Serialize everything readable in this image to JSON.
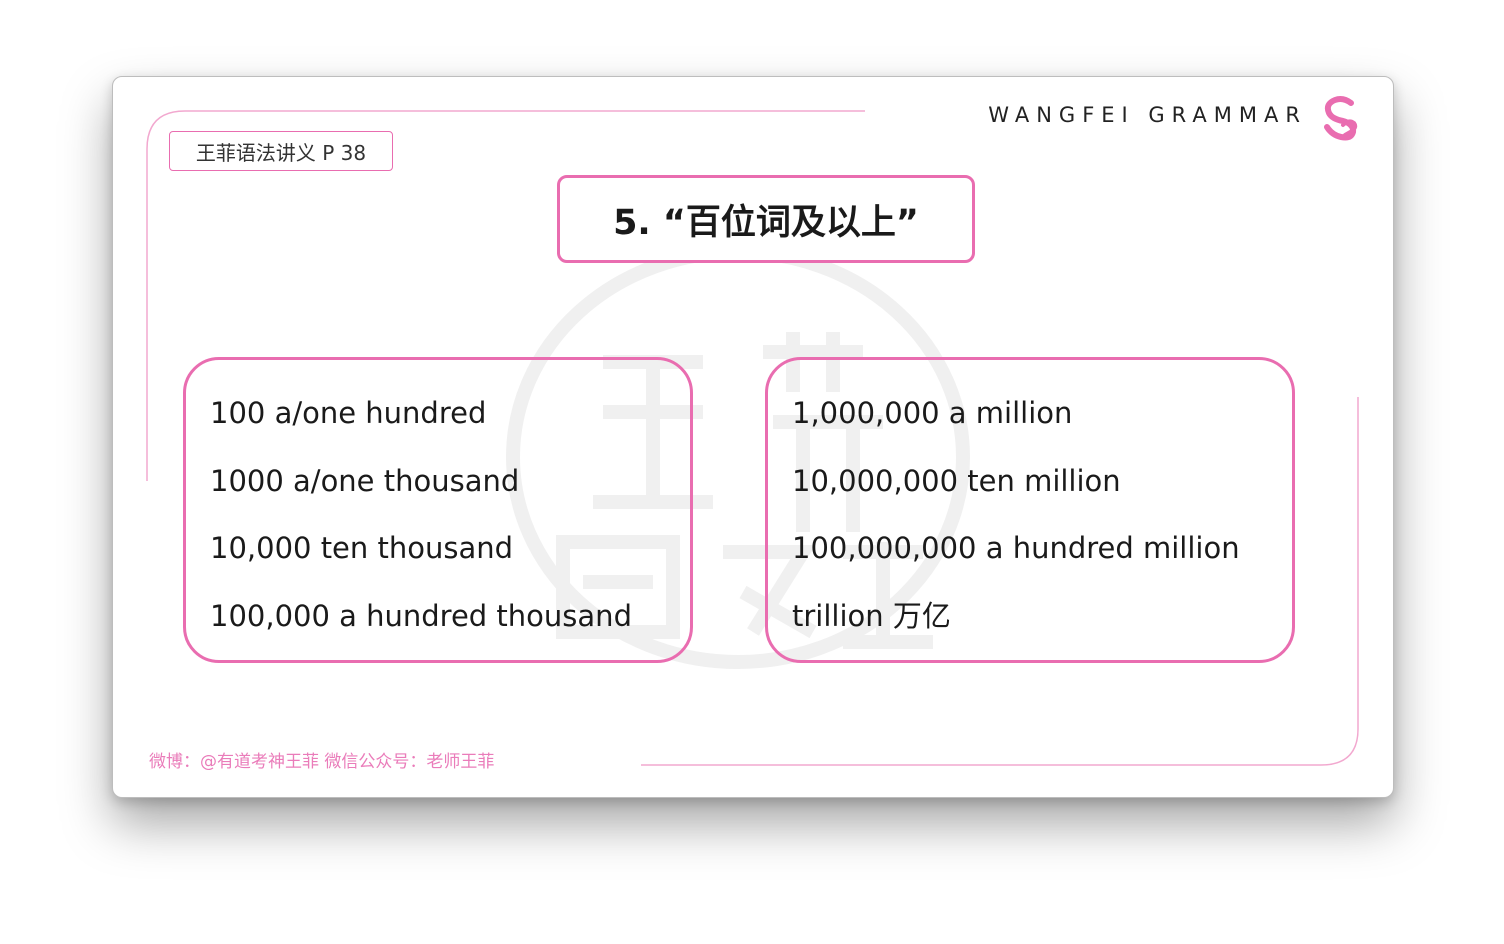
{
  "page_tag": "王菲语法讲义  P 38",
  "brand": {
    "name": "WANGFEI GRAMMAR",
    "logo_icon": "s-heart-logo-icon"
  },
  "title": "5. “百位词及以上”",
  "left_box": {
    "lines": [
      "100 a/one hundred",
      "1000 a/one thousand",
      "10,000 ten thousand",
      "100,000 a hundred thousand"
    ]
  },
  "right_box": {
    "lines": [
      "1,000,000 a million",
      "10,000,000 ten million",
      "100,000,000 a hundred million",
      "trillion 万亿"
    ]
  },
  "footer": "微博：@有道考神王菲  微信公众号：老师王菲",
  "colors": {
    "accent_pink": "#e96db0",
    "footer_pink": "#ea7cba",
    "text": "#1a1a1a"
  }
}
